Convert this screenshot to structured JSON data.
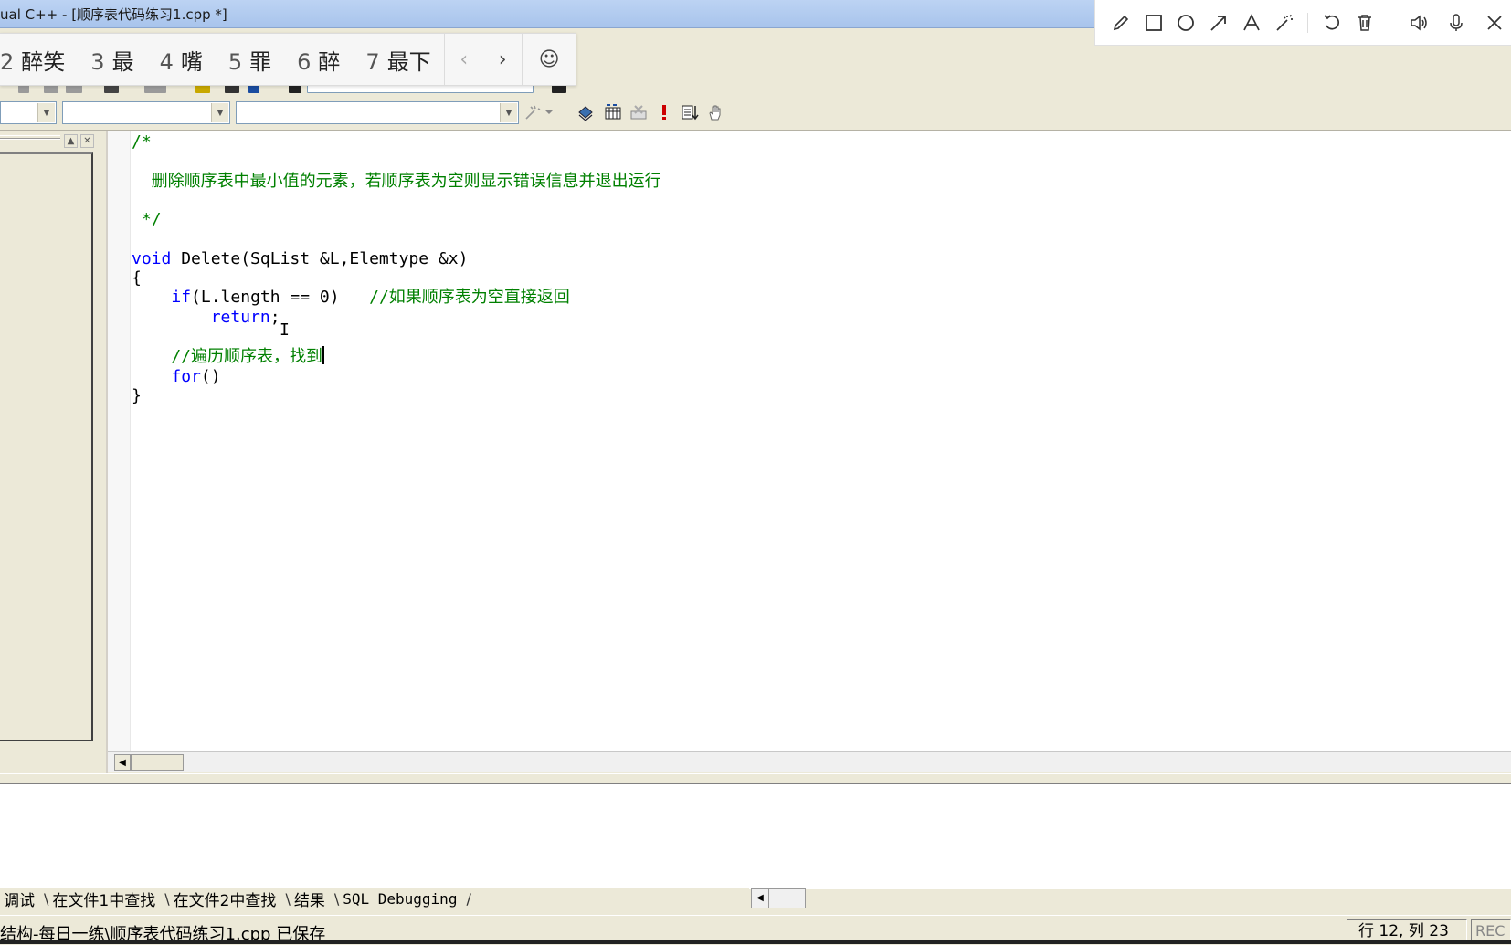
{
  "window": {
    "title": "ual C++ - [顺序表代码练习1.cpp *]"
  },
  "ime": {
    "candidates": [
      {
        "num": "2",
        "text": "醉笑"
      },
      {
        "num": "3",
        "text": "最"
      },
      {
        "num": "4",
        "text": "嘴"
      },
      {
        "num": "5",
        "text": "罪"
      },
      {
        "num": "6",
        "text": "醉"
      },
      {
        "num": "7",
        "text": "最下"
      }
    ],
    "prev": "‹",
    "next": "›",
    "emoji": "☺"
  },
  "annotation_toolbar": {
    "tools": [
      "pencil-icon",
      "rectangle-icon",
      "circle-icon",
      "arrow-icon",
      "text-icon",
      "magic-wand-icon",
      "undo-icon",
      "trash-icon",
      "speaker-icon",
      "microphone-icon",
      "close-icon"
    ]
  },
  "editor": {
    "lines": [
      "/*",
      "",
      "  删除顺序表中最小值的元素，若顺序表为空则显示错误信息并退出运行",
      "",
      " */",
      "",
      "void Delete(SqList &L,Elemtype &x)",
      "{",
      "    if(L.length == 0)   //如果顺序表为空直接返回",
      "        return;",
      "",
      "    //遍历顺序表，找到",
      "    for()",
      "}"
    ],
    "ibeam": "I"
  },
  "output_tabs": [
    "调试",
    "在文件1中查找",
    "在文件2中查找",
    "结果",
    "SQL Debugging"
  ],
  "status": {
    "message": "结构-每日一练\\顺序表代码练习1.cpp 已保存",
    "position": "行 12, 列 23",
    "rec": "REC"
  },
  "colors": {
    "keyword": "#0000ff",
    "comment": "#008000",
    "chrome": "#ece9d8"
  }
}
